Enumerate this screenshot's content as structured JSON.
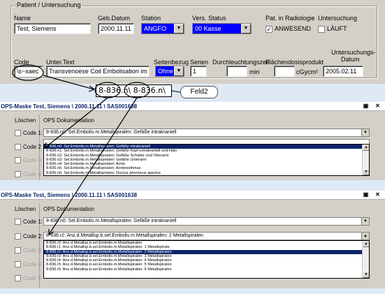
{
  "patient_panel": {
    "group_title": "Patient / Untersuchung",
    "name_label": "Name",
    "name_value": "Test, Siemens",
    "geb_label": "Geb.Datum",
    "geb_value": "2000.11.11",
    "station_label": "Station",
    "station_value": "ANGFO",
    "vers_label": "Vers. Status",
    "vers_value": "00 Kasse",
    "radiologie_label": "Pat. in Radiologie",
    "radiologie_check_label": "ANWESEND",
    "untersuchung_label": "Untersuchung",
    "untersuchung_check_label": "LÄUFT",
    "code_label": "Code",
    "code_value": "\\s~xaec",
    "untertext_label": "Unter.Text",
    "untertext_value": "Transvenoese Coil Embolisation im Schaed",
    "seitenbezug_label": "Seitenbezug",
    "seitenbezug_value": "Ohne",
    "serien_label": "Serien",
    "serien_value": "1",
    "durchleuchtung_label": "Durchleuchtungszeit",
    "durchleuchtung_unit": "min",
    "flaechendosis_label": "Flächendosisprodukt",
    "flaechendosis_unit": "cGycm²",
    "datum_label_1": "Untersuchungs-",
    "datum_label_2": "Datum",
    "datum_value": "2005.02.11"
  },
  "annotation": {
    "zoom_text": "8-836.n\\ 8-836.n\\",
    "feld_label": "Feld2"
  },
  "dialog1": {
    "title": "OPS-Maske Test, Siemens \\ 2000.11.11 \\ SAS001638",
    "col_loeschen": "Löschen",
    "col_ops": "OPS Dokumentation",
    "code1_label": "Code 1:",
    "code1_value": "8-836.n0: Sel.Embolis.m.Metallspiralen: Gefäße intrakraniell",
    "code2_label": "Code 2",
    "code3_label": "Code 3",
    "code4_label": "Code 4",
    "list_items": [
      "8-836.n0: Sel.Embolis.m.Metallspiralen: Gefäße intrakraniell",
      "8-836.n1: Sel.Embolis.m.Metallspiralen: Gefäße Kopf extrakraniell und Hals",
      "8-836.n2: Sel.Embolis.m.Metallspiralen: Gefäße Schulter und Oberarm",
      "8-836.n3: Sel.Embolis.m.Metallspiralen: Gefäße Unterarm",
      "8-836.n4: Sel.Embolis.m.Metallspiralen: Aorta",
      "8-836.n5: Sel.Embolis.m.Metallspiralen: Aortenisthmus",
      "8-836.n6: Sel.Embolis.m.Metallspiralen: Ductus arteriosus apertus"
    ],
    "selected_index": 0
  },
  "dialog2": {
    "title": "OPS-Maske Test, Siemens \\ 2000.11.11 \\ SAS001638",
    "col_loeschen": "Löschen",
    "col_ops": "OPS Dokumentation",
    "code1_label": "Code 1:",
    "code1_value": "8-836.n0: Sel.Embolis.m.Metallspiralen: Gefäße intrakraniell",
    "code2_label": "Code 2:",
    "code2_value": "8-836.r2: Anz.d.Metallsp.b.sel.Embolis.m.Metallspiralen: 2 Metallspiralen",
    "code3_label": "Code 3",
    "code4_label": "Code 4",
    "code5_label": "Code 5",
    "list_items": [
      "8-836.r0: Anz.d.Metallsp.b.sel.Embolis.m.Metallspiralen",
      "8-836.r1: Anz.d.Metallsp.b.sel.Embolis.m.Metallspiralen: 1 Metallspirale",
      "8-836.r2: Anz.d.Metallsp.b.sel.Embolis.m.Metallspiralen: 2 Metallspiralen",
      "8-836.r3: Anz.d.Metallsp.b.sel.Embolis.m.Metallspiralen: 3 Metallspiralen",
      "8-836.r4: Anz.d.Metallsp.b.sel.Embolis.m.Metallspiralen: 4 Metallspiralen",
      "8-836.r5: Anz.d.Metallsp.b.sel.Embolis.m.Metallspiralen: 5 Metallspiralen",
      "8-836.r6: Anz.d.Metallsp.b.sel.Embolis.m.Metallspiralen: 6 Metallspiralen"
    ],
    "selected_index": 2
  },
  "colors": {
    "background": "#dfe9f5",
    "panel": "#d4d0c8",
    "highlight_blue": "#0000ff",
    "selection": "#0a246a",
    "title_text": "#0a246a"
  }
}
